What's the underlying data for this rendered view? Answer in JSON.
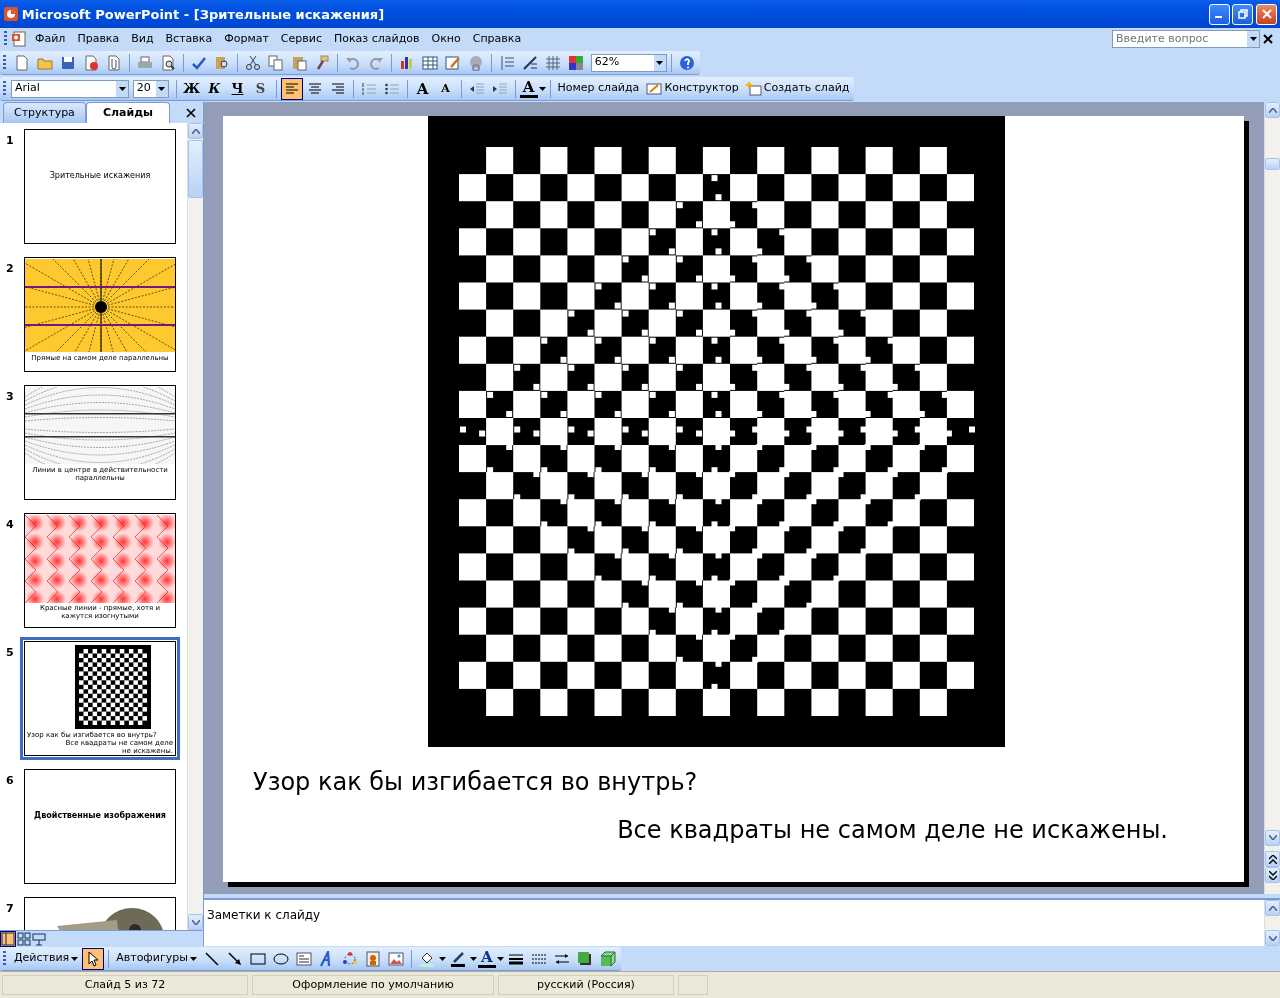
{
  "window": {
    "title": "Microsoft PowerPoint - [Зрительные искажения]"
  },
  "menu": [
    "Файл",
    "Правка",
    "Вид",
    "Вставка",
    "Формат",
    "Сервис",
    "Показ слайдов",
    "Окно",
    "Справка"
  ],
  "help_search": {
    "placeholder": "Введите вопрос"
  },
  "standard_toolbar": {
    "zoom": "62%"
  },
  "formatting_toolbar": {
    "font": "Arial",
    "size": "20",
    "styles": [
      "Ж",
      "К",
      "Ч",
      "S"
    ],
    "alignment": [
      {
        "selected": true
      },
      {
        "selected": false
      },
      {
        "selected": false
      }
    ],
    "grow_font": "A",
    "shrink_font": "A",
    "font_color": "A",
    "commands": [
      "Номер слайда",
      "Конструктор",
      "Создать слайд"
    ]
  },
  "pane_tabs": [
    {
      "label": "Структура",
      "selected": false
    },
    {
      "label": "Слайды",
      "selected": true
    }
  ],
  "thumbnails": [
    {
      "number": "1",
      "kind": "title",
      "selected": false,
      "texts": [
        "Зрительные искажения"
      ]
    },
    {
      "number": "2",
      "kind": "rays",
      "selected": false,
      "texts": [
        "Прямые на самом деле параллельны"
      ]
    },
    {
      "number": "3",
      "kind": "lines",
      "selected": false,
      "texts": [
        "Линии в центре в действительности параллельны"
      ]
    },
    {
      "number": "4",
      "kind": "pattern",
      "selected": false,
      "texts": [
        "Красные линии - прямые, хотя и кажутся изогнутыми"
      ]
    },
    {
      "number": "5",
      "kind": "checker",
      "selected": true,
      "texts": [
        "Узор как бы изгибается во внутрь?",
        "Все квадраты не самом деле не искажены."
      ]
    },
    {
      "number": "6",
      "kind": "title",
      "selected": false,
      "texts": [
        "Двойственные изображения"
      ]
    },
    {
      "number": "7",
      "kind": "picture",
      "selected": false
    }
  ],
  "slide": {
    "question": "Узор как бы изгибается во внутрь?",
    "answer": "Все квадраты не самом деле не искажены."
  },
  "notes": {
    "text": "Заметки к слайду"
  },
  "view_buttons": [
    {
      "selected": true
    },
    {
      "selected": false
    },
    {
      "selected": false
    }
  ],
  "drawing_toolbar": {
    "actions": "Действия",
    "pointer_selected": true,
    "autoshapes": "Автофигуры",
    "font_color": "A"
  },
  "status_bar": [
    "Слайд 5 из 72",
    "Оформление по умолчанию",
    "русский (Россия)"
  ]
}
